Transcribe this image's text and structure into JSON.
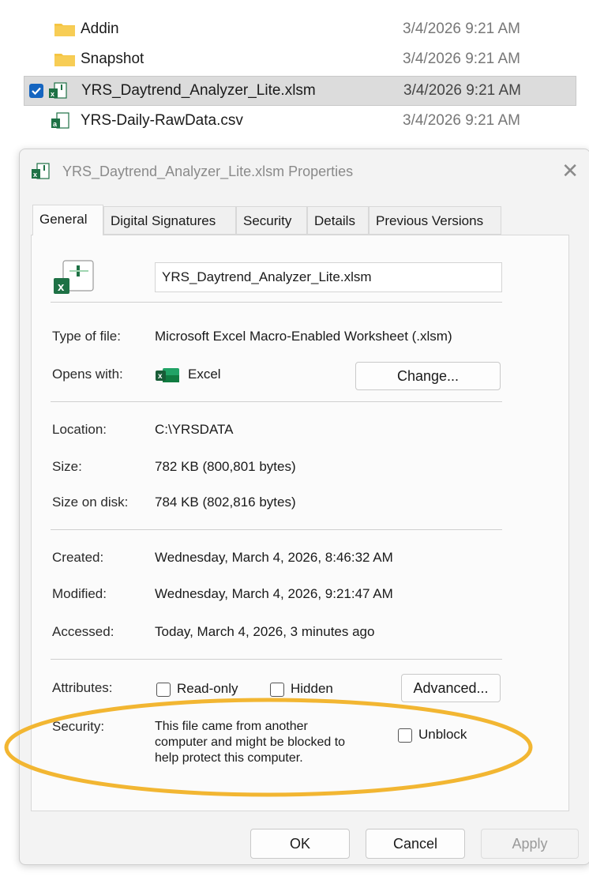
{
  "explorer": {
    "rows": [
      {
        "name": "Addin",
        "date": "3/4/2026 9:21 AM",
        "icon": "folder-icon"
      },
      {
        "name": "Snapshot",
        "date": "3/4/2026 9:21 AM",
        "icon": "folder-icon"
      },
      {
        "name": "YRS_Daytrend_Analyzer_Lite.xlsm",
        "date": "3/4/2026 9:21 AM",
        "icon": "excel-macro-icon",
        "selected": true
      },
      {
        "name": "YRS-Daily-RawData.csv",
        "date": "3/4/2026 9:21 AM",
        "icon": "excel-csv-icon"
      }
    ]
  },
  "dialog": {
    "title": "YRS_Daytrend_Analyzer_Lite.xlsm Properties",
    "close_glyph": "✕",
    "tabs": [
      "General",
      "Digital Signatures",
      "Security",
      "Details",
      "Previous Versions"
    ],
    "active_tab": "General",
    "filename": "YRS_Daytrend_Analyzer_Lite.xlsm",
    "type_label": "Type of file:",
    "type_value": "Microsoft Excel Macro-Enabled Worksheet (.xlsm)",
    "opens_label": "Opens with:",
    "opens_value": "Excel",
    "change_button": "Change...",
    "location_label": "Location:",
    "location_value": "C:\\YRSDATA",
    "size_label": "Size:",
    "size_value": "782 KB (800,801 bytes)",
    "disk_label": "Size on disk:",
    "disk_value": "784 KB (802,816 bytes)",
    "created_label": "Created:",
    "created_value": "Wednesday, March 4, 2026, 8:46:32 AM",
    "modified_label": "Modified:",
    "modified_value": "Wednesday, March 4, 2026, 9:21:47 AM",
    "accessed_label": "Accessed:",
    "accessed_value": "Today, March 4, 2026, 3 minutes ago",
    "attributes_label": "Attributes:",
    "readonly_label": "Read-only",
    "hidden_label": "Hidden",
    "advanced_button": "Advanced...",
    "security_label": "Security:",
    "security_line1": "This file came from another",
    "security_line2": "computer and might be blocked to",
    "security_line3": "help protect this computer.",
    "unblock_label": "Unblock",
    "ok_button": "OK",
    "cancel_button": "Cancel",
    "apply_button": "Apply"
  },
  "colors": {
    "highlight": "#f2b632",
    "excel_green": "#1e7145",
    "folder_yellow": "#f5c542",
    "select_blue": "#1565c0"
  }
}
